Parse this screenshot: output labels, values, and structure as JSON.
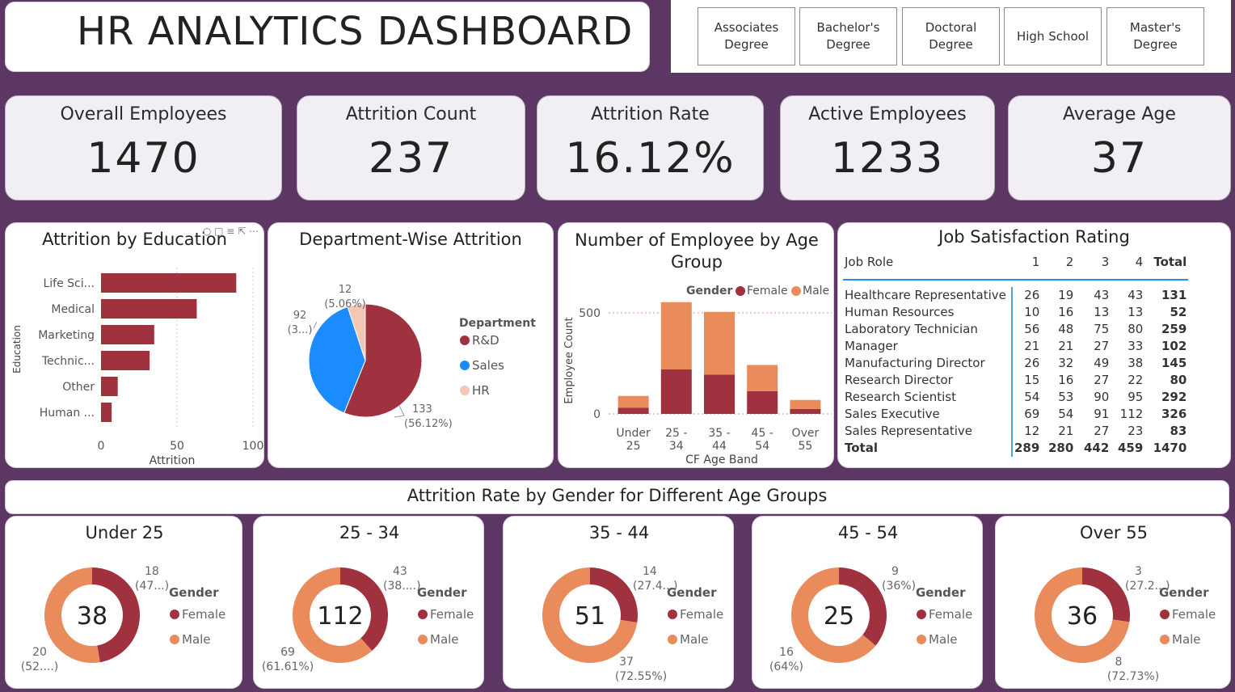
{
  "header": {
    "title": "HR ANALYTICS DASHBOARD"
  },
  "slicer": {
    "items": [
      "Associates\nDegree",
      "Bachelor's\nDegree",
      "Doctoral\nDegree",
      "High School",
      "Master's\nDegree"
    ]
  },
  "kpis": [
    {
      "label": "Overall Employees",
      "value": "1470"
    },
    {
      "label": "Attrition Count",
      "value": "237"
    },
    {
      "label": "Attrition Rate",
      "value": "16.12%"
    },
    {
      "label": "Active Employees",
      "value": "1233"
    },
    {
      "label": "Average Age",
      "value": "37"
    }
  ],
  "colors": {
    "background": "#5c3764",
    "female": "#a0313f",
    "male": "#ea8b5c",
    "sales": "#1a8cff",
    "hr": "#f4c6b4"
  },
  "chart_data": [
    {
      "id": "education",
      "type": "bar",
      "orientation": "horizontal",
      "title": "Attrition by Education",
      "categories": [
        "Life Sci...",
        "Medical",
        "Marketing",
        "Technic...",
        "Other",
        "Human ..."
      ],
      "values": [
        89,
        63,
        35,
        32,
        11,
        7
      ],
      "xlabel": "Attrition",
      "ylabel": "Education",
      "xlim": [
        0,
        100
      ],
      "xticks": [
        "0",
        "50",
        "100"
      ],
      "color": "#a0313f"
    },
    {
      "id": "department",
      "type": "pie",
      "title": "Department-Wise Attrition",
      "legend_title": "Department",
      "slices": [
        {
          "name": "R&D",
          "value": 133,
          "label1": "133",
          "label2": "(56.12%)",
          "color": "#a0313f"
        },
        {
          "name": "Sales",
          "value": 92,
          "label1": "92",
          "label2": "(3...)",
          "color": "#1a8cff"
        },
        {
          "name": "HR",
          "value": 12,
          "label1": "12",
          "label2": "(5.06%)",
          "color": "#f4c6b4"
        }
      ]
    },
    {
      "id": "agegroup",
      "type": "bar",
      "stacked": true,
      "title": "Number of Employee by Age Group",
      "legend_title": "Gender",
      "categories": [
        [
          "Under",
          "25"
        ],
        [
          "25 -",
          "34"
        ],
        [
          "35 -",
          "44"
        ],
        [
          "45 -",
          "54"
        ],
        [
          "Over",
          "55"
        ]
      ],
      "series": [
        {
          "name": "Female",
          "values": [
            30,
            220,
            195,
            112,
            25
          ],
          "color": "#a0313f"
        },
        {
          "name": "Male",
          "values": [
            59,
            333,
            310,
            130,
            44
          ],
          "color": "#ea8b5c"
        }
      ],
      "xlabel": "CF Age Band",
      "ylabel": "Employee Count",
      "yticks": [
        "0",
        "500"
      ],
      "ylim": [
        0,
        560
      ]
    },
    {
      "id": "genderage",
      "type": "pie",
      "variant": "donut",
      "title": "Attrition Rate by Gender for Different Age Groups",
      "legend_title": "Gender",
      "legend": [
        "Female",
        "Male"
      ],
      "groups": [
        {
          "name": "Under 25",
          "total": "38",
          "female": 18,
          "male": 20,
          "female_label": [
            "18",
            "(47...)"
          ],
          "male_label": [
            "20",
            "(52....)"
          ]
        },
        {
          "name": "25 - 34",
          "total": "112",
          "female": 43,
          "male": 69,
          "female_label": [
            "43",
            "(38....)"
          ],
          "male_label": [
            "69",
            "(61.61%)"
          ]
        },
        {
          "name": "35 - 44",
          "total": "51",
          "female": 14,
          "male": 37,
          "female_label": [
            "14",
            "(27.4...)"
          ],
          "male_label": [
            "37",
            "(72.55%)"
          ]
        },
        {
          "name": "45 - 54",
          "total": "25",
          "female": 9,
          "male": 16,
          "female_label": [
            "9",
            "(36%)"
          ],
          "male_label": [
            "16",
            "(64%)"
          ]
        },
        {
          "name": "Over 55",
          "total": "36",
          "female": 3,
          "male": 8,
          "female_label": [
            "3",
            "(27.2...)"
          ],
          "male_label": [
            "8",
            "(72.73%)"
          ]
        }
      ]
    }
  ],
  "job_satisfaction": {
    "title": "Job Satisfaction Rating",
    "headers": [
      "Job Role",
      "1",
      "2",
      "3",
      "4",
      "Total"
    ],
    "rows": [
      [
        "Healthcare Representative",
        "26",
        "19",
        "43",
        "43",
        "131"
      ],
      [
        "Human Resources",
        "10",
        "16",
        "13",
        "13",
        "52"
      ],
      [
        "Laboratory Technician",
        "56",
        "48",
        "75",
        "80",
        "259"
      ],
      [
        "Manager",
        "21",
        "21",
        "27",
        "33",
        "102"
      ],
      [
        "Manufacturing Director",
        "26",
        "32",
        "49",
        "38",
        "145"
      ],
      [
        "Research Director",
        "15",
        "16",
        "27",
        "22",
        "80"
      ],
      [
        "Research Scientist",
        "54",
        "53",
        "90",
        "95",
        "292"
      ],
      [
        "Sales Executive",
        "69",
        "54",
        "91",
        "112",
        "326"
      ],
      [
        "Sales Representative",
        "12",
        "21",
        "27",
        "23",
        "83"
      ]
    ],
    "total": [
      "Total",
      "289",
      "280",
      "442",
      "459",
      "1470"
    ]
  }
}
